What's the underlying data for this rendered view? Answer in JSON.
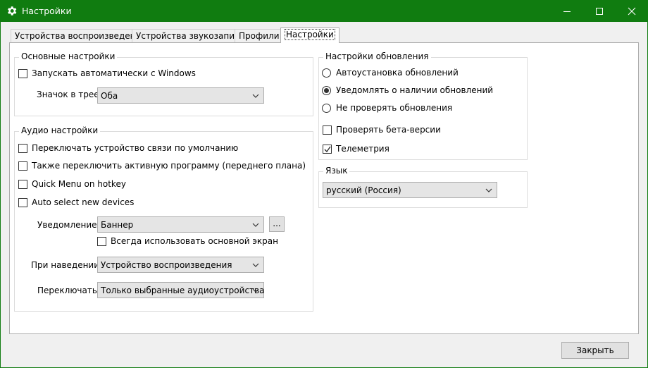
{
  "window": {
    "title": "Настройки",
    "icon": "gear-icon",
    "accent_color": "#107c10"
  },
  "tabs": [
    {
      "label": "Устройства воспроизведения",
      "active": false
    },
    {
      "label": "Устройства звукозаписи",
      "active": false
    },
    {
      "label": "Профили",
      "active": false
    },
    {
      "label": "Настройки",
      "active": true
    }
  ],
  "basic": {
    "title": "Основные настройки",
    "autostart_label": "Запускать автоматически с Windows",
    "autostart_checked": false,
    "tray_label": "Значок в трее",
    "tray_value": "Оба"
  },
  "audio": {
    "title": "Аудио настройки",
    "switch_comm_label": "Переключать устройство связи по умолчанию",
    "switch_comm_checked": false,
    "switch_foreground_label": "Также переключить активную программу (переднего плана)",
    "switch_foreground_checked": false,
    "quick_menu_label": "Quick Menu on hotkey",
    "quick_menu_checked": false,
    "auto_select_label": "Auto select new devices",
    "auto_select_checked": false,
    "notification_label": "Уведомление",
    "notification_value": "Баннер",
    "more_button": "...",
    "primary_screen_label": "Всегда использовать основной экран",
    "primary_screen_checked": false,
    "hover_label": "При наведении",
    "hover_value": "Устройство воспроизведения",
    "switch_label": "Переключать",
    "switch_value": "Только выбранные аудиоустройства"
  },
  "updates": {
    "title": "Настройки обновления",
    "options": [
      {
        "label": "Автоустановка обновлений",
        "selected": false
      },
      {
        "label": "Уведомлять о наличии обновлений",
        "selected": true
      },
      {
        "label": "Не проверять обновления",
        "selected": false
      }
    ],
    "beta_label": "Проверять бета-версии",
    "beta_checked": false,
    "telemetry_label": "Телеметрия",
    "telemetry_checked": true
  },
  "language": {
    "title": "Язык",
    "value": "русский (Россия)"
  },
  "footer": {
    "close_label": "Закрыть"
  }
}
